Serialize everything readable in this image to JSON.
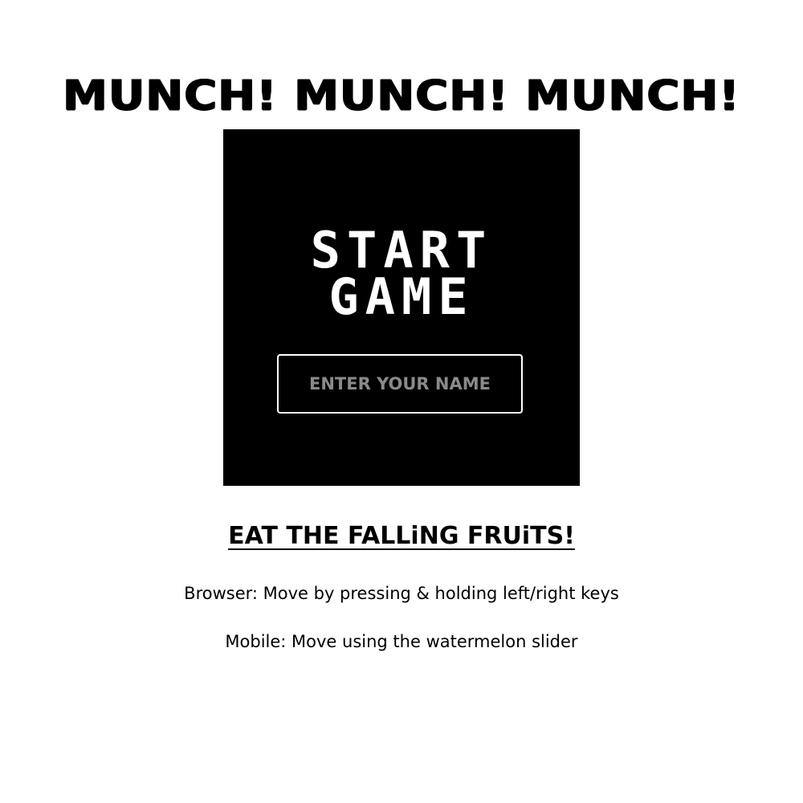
{
  "page": {
    "title": "MUNCH! MUNCH! MUNCH!"
  },
  "game": {
    "start_line1": "START",
    "start_line2": "GAME",
    "name_placeholder": "ENTER YOUR NAME",
    "name_value": ""
  },
  "instructions": {
    "heading": "EAT THE FALLiNG FRUiTS!",
    "browser": "Browser: Move by pressing & holding left/right keys",
    "mobile": "Mobile: Move using the watermelon slider"
  },
  "colors": {
    "background": "#ffffff",
    "game_box": "#000000",
    "text_primary": "#000000",
    "start_text": "#ffffff",
    "input_border": "#ffffff",
    "placeholder": "#8a8a8a"
  }
}
